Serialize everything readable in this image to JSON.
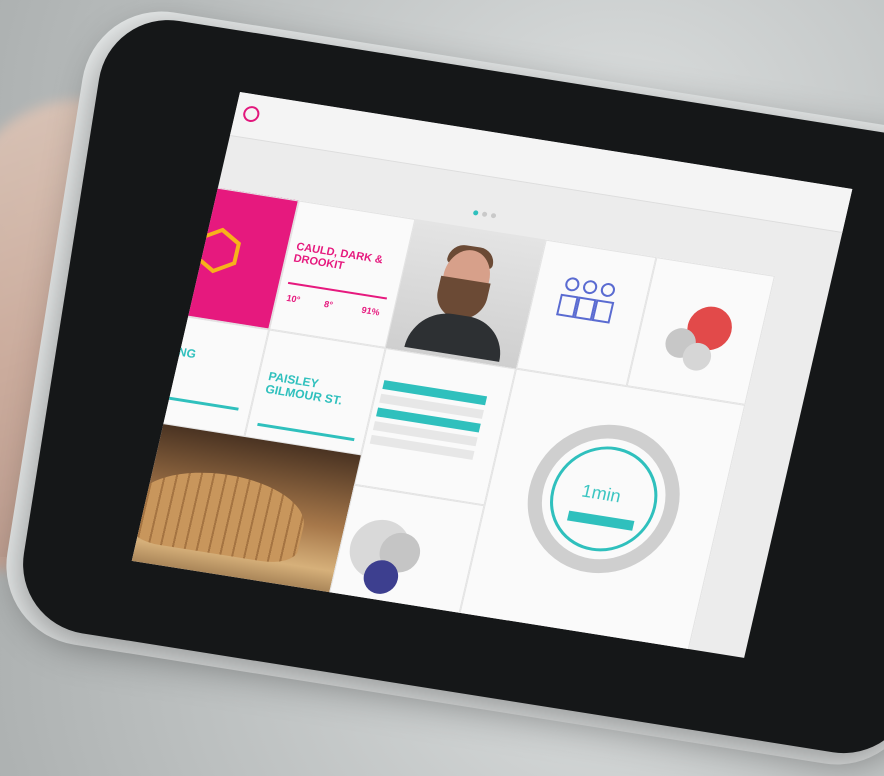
{
  "screen": {
    "tiles": {
      "weather_title": "CAULD, DARK &\nDROOKIT",
      "weather_temp_1": "10°",
      "weather_temp_2": "8°",
      "weather_pct": "91%",
      "location_1": "STIRLING",
      "location_2": "PAISLEY\nGILMOUR ST.",
      "timer_value": "1min"
    },
    "pager": {
      "active_index": 0,
      "count": 3
    }
  },
  "colors": {
    "accent_magenta": "#e6197e",
    "accent_teal": "#2fc0bd",
    "hex_yellow": "#f7b21b",
    "coral": "#e24a4a"
  }
}
